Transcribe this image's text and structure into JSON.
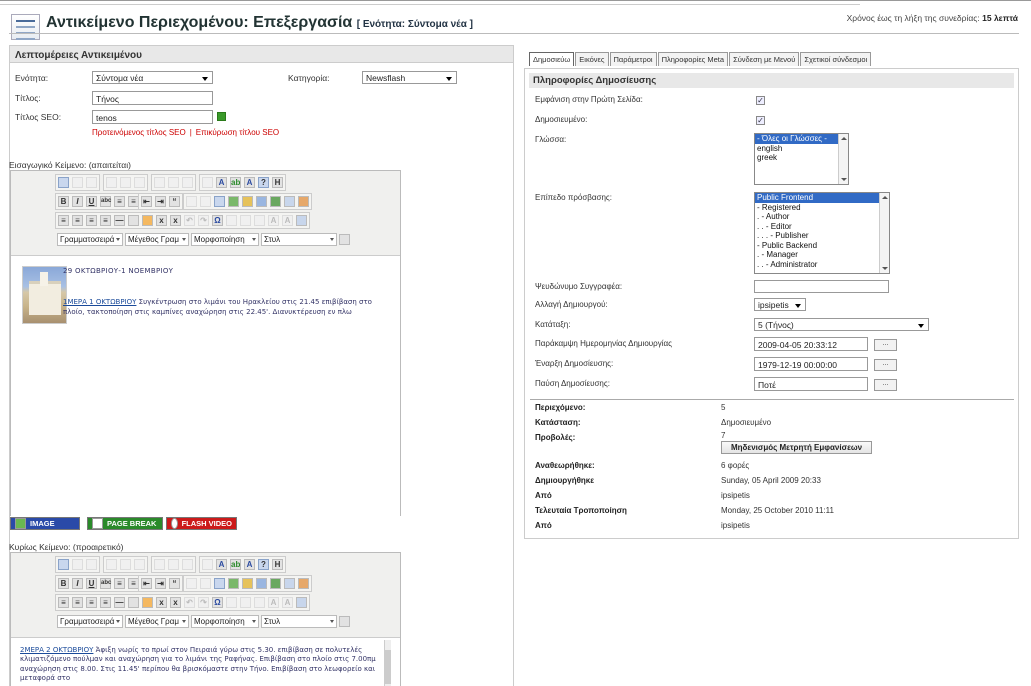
{
  "header": {
    "title": "Αντικείμενο Περιεχομένου: Επεξεργασία",
    "section": "[ Ενότητα: Σύντομα νέα ]",
    "session_label": "Χρόνος έως τη λήξη της συνεδρίας:",
    "session_value": "15 λεπτά"
  },
  "details": {
    "heading": "Λεπτομέρειες Αντικειμένου",
    "section_label": "Ενότητα:",
    "section_value": "Σύντομα νέα",
    "category_label": "Κατηγορία:",
    "category_value": "Newsflash",
    "title_label": "Τίτλος:",
    "title_value": "Τήνος",
    "seo_label": "Τίτλος SEO:",
    "seo_value": "tenos",
    "seo_suggested": "Προτεινόμενος τίτλος SEO",
    "seo_cancel": "Επικύρωση τίτλου SEO",
    "seo_separator": "|"
  },
  "intro": {
    "label": "Εισαγωγικό Κείμενο: (απαιτείται)",
    "heading": "29 ΟΚΤΩΒΡΙΟΥ-1 ΝΟΕΜΒΡΙΟΥ",
    "day_link": "1ΜΕΡΑ 1 ΟΚΤΩΒΡΙΟΥ",
    "text": " Συγκέντρωση στο λιμάνι του Ηρακλείου στις 21.45 επιβίβαση στο πλοίο, τακτοποίηση στις καμπίνες αναχώρηση στις 22.45'. Διανυκτέρευση εν πλω"
  },
  "editor_selects": {
    "font_family": "Γραμματοσειρά",
    "font_size": "Μέγεθος Γραμ",
    "format": "Μορφοποίηση",
    "style": "Στυλ"
  },
  "insert_buttons": {
    "image": "IMAGE",
    "page_break": "PAGE BREAK",
    "flash_video": "FLASH VIDEO"
  },
  "main_text": {
    "label": "Κυρίως Κείμενο: (προαιρετικό)",
    "day_link": "2ΜΕΡΑ 2 ΟΚΤΩΒΡΙΟΥ",
    "text": " Άφιξη νωρίς το πρωί στον Πειραιά γύρω στις 5.30. επιβίβαση σε πολυτελές κλιματιζόμενο πούλμαν και αναχώρηση για το λιμάνι της Ραφήνας. Επιβίβαση στο πλοίο στις 7.00πμ αναχώρηση στις 8.00. Στις 11.45' περίπου θα βρισκόμαστε στην Τήνο. Επιβίβαση στο λεωφορείο και μεταφορά στο"
  },
  "tabs": [
    "Δημοσιεύω",
    "Εικόνες",
    "Παράμετροι",
    "Πληροφορίες Meta",
    "Σύνδεση με Μενού",
    "Σχετικοί σύνδεσμοι"
  ],
  "publishing": {
    "heading": "Πληροφορίες Δημοσίευσης",
    "frontpage_label": "Εμφάνιση στην Πρώτη Σελίδα:",
    "frontpage_checked": true,
    "published_label": "Δημοσιευμένο:",
    "published_checked": true,
    "language_label": "Γλώσσα:",
    "languages": [
      "- Όλες οι Γλώσσες -",
      "english",
      "greek"
    ],
    "access_label": "Επίπεδο πρόσβασης:",
    "access_levels": [
      "Public Frontend",
      "- Registered",
      ". - Author",
      ". . - Editor",
      ". . . - Publisher",
      "- Public Backend",
      ". - Manager",
      ". . - Administrator"
    ],
    "alias_label": "Ψευδώνυμο Συγγραφέα:",
    "alias_value": "",
    "creator_label": "Αλλαγή Δημιουργού:",
    "creator_value": "ipsipetis",
    "ordering_label": "Κατάταξη:",
    "ordering_value": "5 (Τήνος)",
    "created_label": "Παράκαμψη Ημερομηνίας Δημιουργίας",
    "created_value": "2009-04-05 20:33:12",
    "publish_up_label": "Έναρξη Δημοσίευσης:",
    "publish_up_value": "1979-12-19 00:00:00",
    "publish_down_label": "Παύση Δημοσίευσης:",
    "publish_down_value": "Ποτέ",
    "date_button": "..."
  },
  "stats": {
    "content_label": "Περιεχόμενο:",
    "content_value": "5",
    "state_label": "Κατάσταση:",
    "state_value": "Δημοσιευμένο",
    "hits_label": "Προβολές:",
    "hits_value": "7",
    "reset_button": "Μηδενισμός Μετρητή Εμφανίσεων",
    "revised_label": "Αναθεωρήθηκε:",
    "revised_value": "6 φορές",
    "created_label": "Δημιουργήθηκε",
    "created_value": "Sunday, 05 April 2009 20:33",
    "created_by_label": "Από",
    "created_by_value": "ipsipetis",
    "modified_label": "Τελευταία Τροποποίηση",
    "modified_value": "Monday, 25 October 2010 11:11",
    "modified_by_label": "Από",
    "modified_by_value": "ipsipetis"
  }
}
